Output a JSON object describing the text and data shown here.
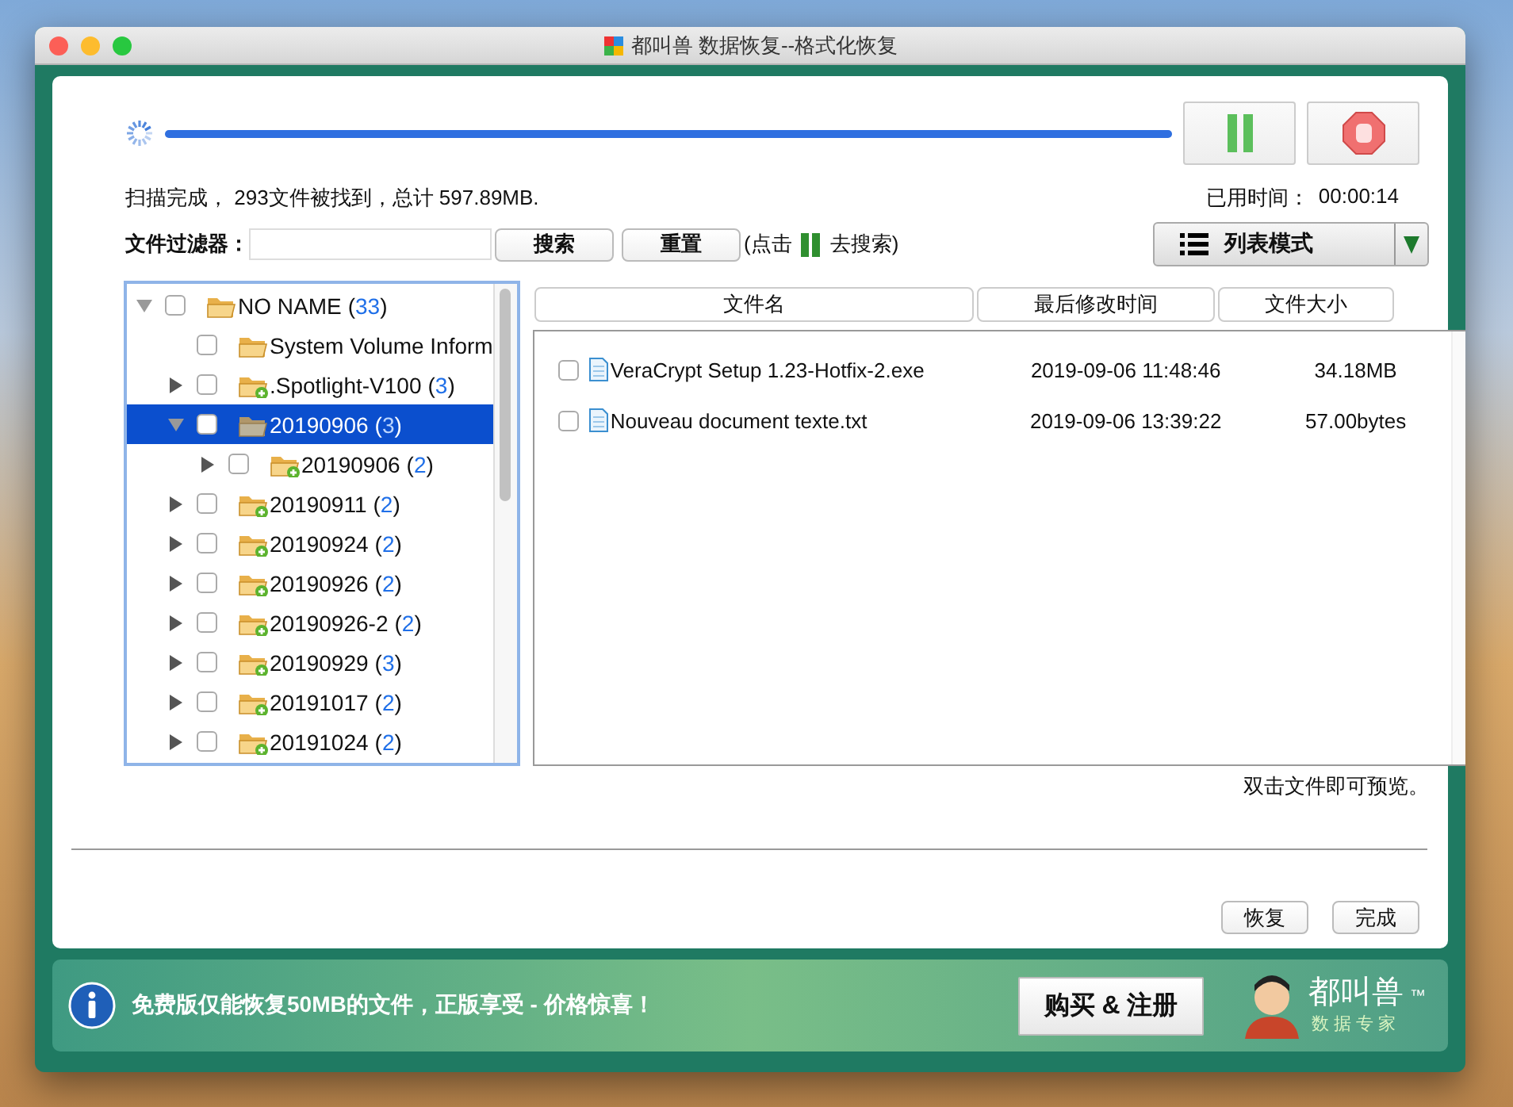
{
  "window": {
    "title": "都叫兽 数据恢复--格式化恢复"
  },
  "scan": {
    "level": 1,
    "status": "扫描完成， 293文件被找到，总计 597.89MB.",
    "elapsed_label": "已用时间：",
    "elapsed": "00:00:14"
  },
  "filter": {
    "label": "文件过滤器：",
    "buttons": [
      "搜索",
      "重置"
    ],
    "hint_before": "(点击",
    "hint_after": "去搜索)"
  },
  "view_mode": {
    "label": "列表模式"
  },
  "tree": [
    {
      "label": "NO NAME",
      "count": "(33)",
      "checked": false,
      "selected": false,
      "expandable": true,
      "expanded": true,
      "kind": "folder",
      "children": [
        {
          "label": "System Volume Inform",
          "checked": false,
          "selected": false,
          "expandable": false,
          "kind": "folder"
        },
        {
          "label": ".Spotlight-V100",
          "count": "(3)",
          "checked": false,
          "selected": false,
          "expandable": true,
          "expanded": false,
          "kind": "folder-plus"
        },
        {
          "label": "20190906",
          "count": "(3)",
          "checked": false,
          "selected": true,
          "expandable": true,
          "expanded": true,
          "kind": "folder",
          "children": [
            {
              "label": "20190906",
              "count": "(2)",
              "checked": false,
              "selected": false,
              "expandable": true,
              "expanded": false,
              "kind": "folder-plus"
            }
          ]
        },
        {
          "label": "20190911",
          "count": "(2)",
          "checked": false,
          "selected": false,
          "expandable": true,
          "expanded": false,
          "kind": "folder-plus"
        },
        {
          "label": "20190924",
          "count": "(2)",
          "checked": false,
          "selected": false,
          "expandable": true,
          "expanded": false,
          "kind": "folder-plus"
        },
        {
          "label": "20190926",
          "count": "(2)",
          "checked": false,
          "selected": false,
          "expandable": true,
          "expanded": false,
          "kind": "folder-plus"
        },
        {
          "label": "20190926-2",
          "count": "(2)",
          "checked": false,
          "selected": false,
          "expandable": true,
          "expanded": false,
          "kind": "folder-plus"
        },
        {
          "label": "20190929",
          "count": "(3)",
          "checked": false,
          "selected": false,
          "expandable": true,
          "expanded": false,
          "kind": "folder-plus"
        },
        {
          "label": "20191017",
          "count": "(2)",
          "checked": false,
          "selected": false,
          "expandable": true,
          "expanded": false,
          "kind": "folder-plus"
        },
        {
          "label": "20191024",
          "count": "(2)",
          "checked": false,
          "selected": false,
          "expandable": true,
          "expanded": false,
          "kind": "folder-plus"
        }
      ]
    }
  ],
  "file_table": {
    "columns": [
      "文件名",
      "最后修改时间",
      "文件大小"
    ],
    "rows": [
      {
        "checked": false,
        "name": "VeraCrypt Setup 1.23-Hotfix-2.exe",
        "modified": "2019-09-06 11:48:46",
        "size": "34.18MB"
      },
      {
        "checked": false,
        "name": "Nouveau document texte.txt",
        "modified": "2019-09-06 13:39:22",
        "size": "57.00bytes"
      }
    ]
  },
  "preview_hint": "双击文件即可预览。",
  "buttons": [
    "恢复",
    "完成"
  ],
  "promo": {
    "message": "免费版仅能恢复50MB的文件，正版享受 - 价格惊喜！",
    "buy_button": "购买 & 注册",
    "logo_title": "都叫兽",
    "logo_subtitle": "数据专家",
    "trademark": "™"
  }
}
